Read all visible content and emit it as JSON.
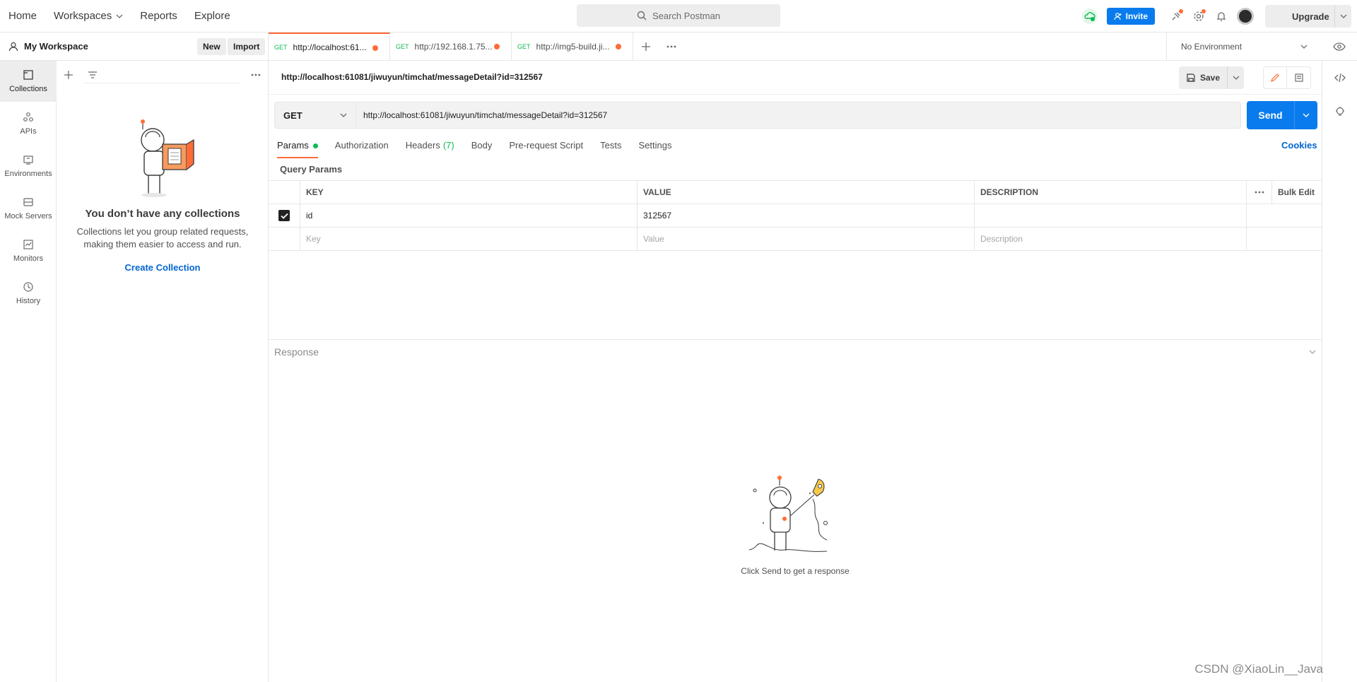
{
  "topnav": {
    "home": "Home",
    "workspaces": "Workspaces",
    "reports": "Reports",
    "explore": "Explore",
    "search_placeholder": "Search Postman",
    "invite": "Invite",
    "upgrade": "Upgrade"
  },
  "workspace": {
    "title": "My Workspace",
    "new_label": "New",
    "import_label": "Import"
  },
  "rail": [
    {
      "label": "Collections",
      "icon": "collections-icon",
      "active": true
    },
    {
      "label": "APIs",
      "icon": "apis-icon"
    },
    {
      "label": "Environments",
      "icon": "environments-icon"
    },
    {
      "label": "Mock Servers",
      "icon": "mock-servers-icon"
    },
    {
      "label": "Monitors",
      "icon": "monitors-icon"
    },
    {
      "label": "History",
      "icon": "history-icon"
    }
  ],
  "sidebar": {
    "empty_title": "You don’t have any collections",
    "empty_text": "Collections let you group related requests, making them easier to access and run.",
    "create_link": "Create Collection"
  },
  "tabs": [
    {
      "method": "GET",
      "label": "http://localhost:61...",
      "active": true
    },
    {
      "method": "GET",
      "label": "http://192.168.1.75..."
    },
    {
      "method": "GET",
      "label": "http://img5-build.ji..."
    }
  ],
  "environment": "No Environment",
  "request": {
    "title": "http://localhost:61081/jiwuyun/timchat/messageDetail?id=312567",
    "save_label": "Save",
    "method": "GET",
    "url": "http://localhost:61081/jiwuyun/timchat/messageDetail?id=312567",
    "send_label": "Send"
  },
  "reqtabs": {
    "params": "Params",
    "authorization": "Authorization",
    "headers": "Headers",
    "headers_count": "(7)",
    "body": "Body",
    "prerequest": "Pre-request Script",
    "tests": "Tests",
    "settings": "Settings",
    "cookies": "Cookies"
  },
  "query_params": {
    "title": "Query Params",
    "headers": {
      "key": "KEY",
      "value": "VALUE",
      "description": "DESCRIPTION",
      "bulk_edit": "Bulk Edit"
    },
    "rows": [
      {
        "key": "id",
        "value": "312567",
        "description": "",
        "checked": true
      }
    ],
    "placeholders": {
      "key": "Key",
      "value": "Value",
      "description": "Description"
    }
  },
  "response": {
    "label": "Response",
    "hint": "Click Send to get a response"
  },
  "watermark": "CSDN @XiaoLin__Java",
  "colors": {
    "accent": "#ff6c37",
    "primary": "#097bed",
    "link": "#0265d2",
    "method_get": "#0cbb52"
  }
}
